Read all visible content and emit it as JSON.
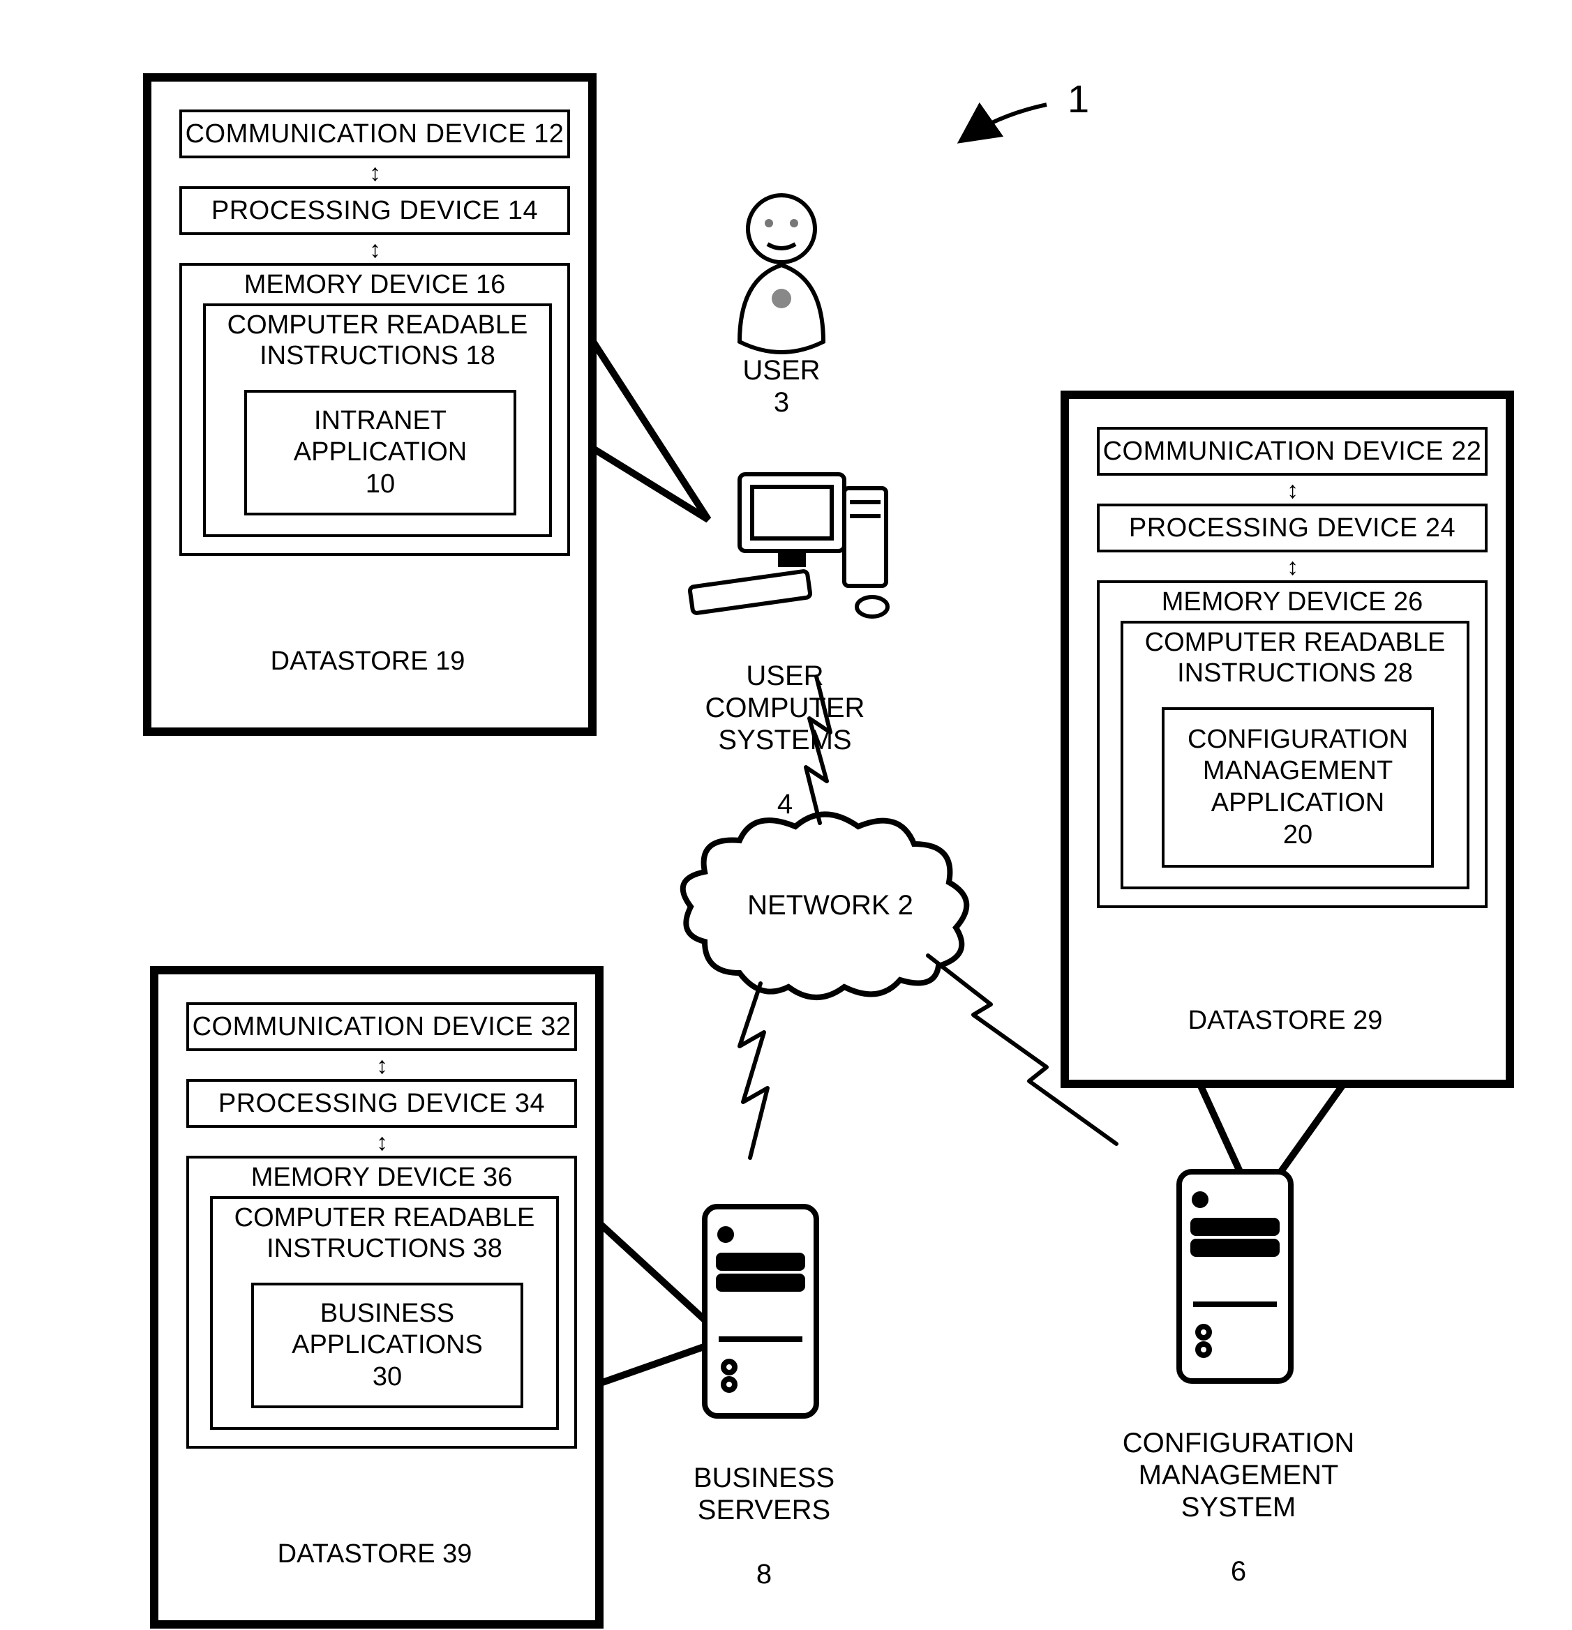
{
  "figure_ref": "1",
  "user": {
    "label": "USER",
    "num": "3"
  },
  "user_cs": {
    "label": "USER\nCOMPUTER\nSYSTEMS",
    "num": "4"
  },
  "network": {
    "label": "NETWORK 2"
  },
  "business_servers": {
    "label": "BUSINESS\nSERVERS",
    "num": "8"
  },
  "config_system": {
    "label": "CONFIGURATION\nMANAGEMENT\nSYSTEM",
    "num": "6"
  },
  "box_a": {
    "comm": "COMMUNICATION DEVICE 12",
    "proc": "PROCESSING DEVICE 14",
    "mem": "MEMORY DEVICE 16",
    "cri": "COMPUTER READABLE\nINSTRUCTIONS 18",
    "app": "INTRANET\nAPPLICATION\n10",
    "datastore": "DATASTORE 19"
  },
  "box_b": {
    "comm": "COMMUNICATION DEVICE 22",
    "proc": "PROCESSING DEVICE 24",
    "mem": "MEMORY DEVICE 26",
    "cri": "COMPUTER READABLE\nINSTRUCTIONS 28",
    "app": "CONFIGURATION\nMANAGEMENT\nAPPLICATION\n20",
    "datastore": "DATASTORE 29"
  },
  "box_c": {
    "comm": "COMMUNICATION DEVICE 32",
    "proc": "PROCESSING DEVICE 34",
    "mem": "MEMORY DEVICE 36",
    "cri": "COMPUTER READABLE\nINSTRUCTIONS 38",
    "app": "BUSINESS\nAPPLICATIONS\n30",
    "datastore": "DATASTORE 39"
  }
}
